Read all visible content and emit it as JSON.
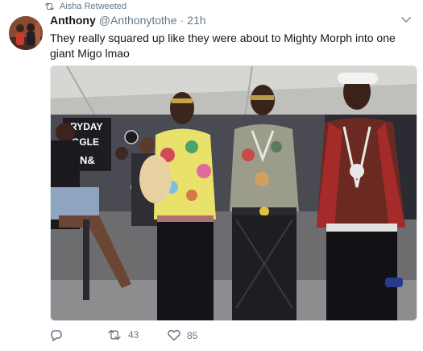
{
  "retweet_context": {
    "label": "Aisha Retweeted"
  },
  "tweet": {
    "display_name": "Anthony",
    "handle": "@Anthonytothe",
    "separator": "·",
    "time": "21h",
    "text": "They really squared up like they were about to Mighty Morph into one giant Migo lmao"
  },
  "media": {
    "backdrop_lines": [
      "RYDAY",
      "GGLE",
      "N&"
    ]
  },
  "actions": {
    "reply": {
      "icon": "reply-icon"
    },
    "retweet": {
      "icon": "retweet-icon",
      "count": "43"
    },
    "like": {
      "icon": "heart-icon",
      "count": "85"
    }
  },
  "colors": {
    "text_primary": "#14171a",
    "text_secondary": "#657786",
    "border": "#e1e8ed"
  }
}
